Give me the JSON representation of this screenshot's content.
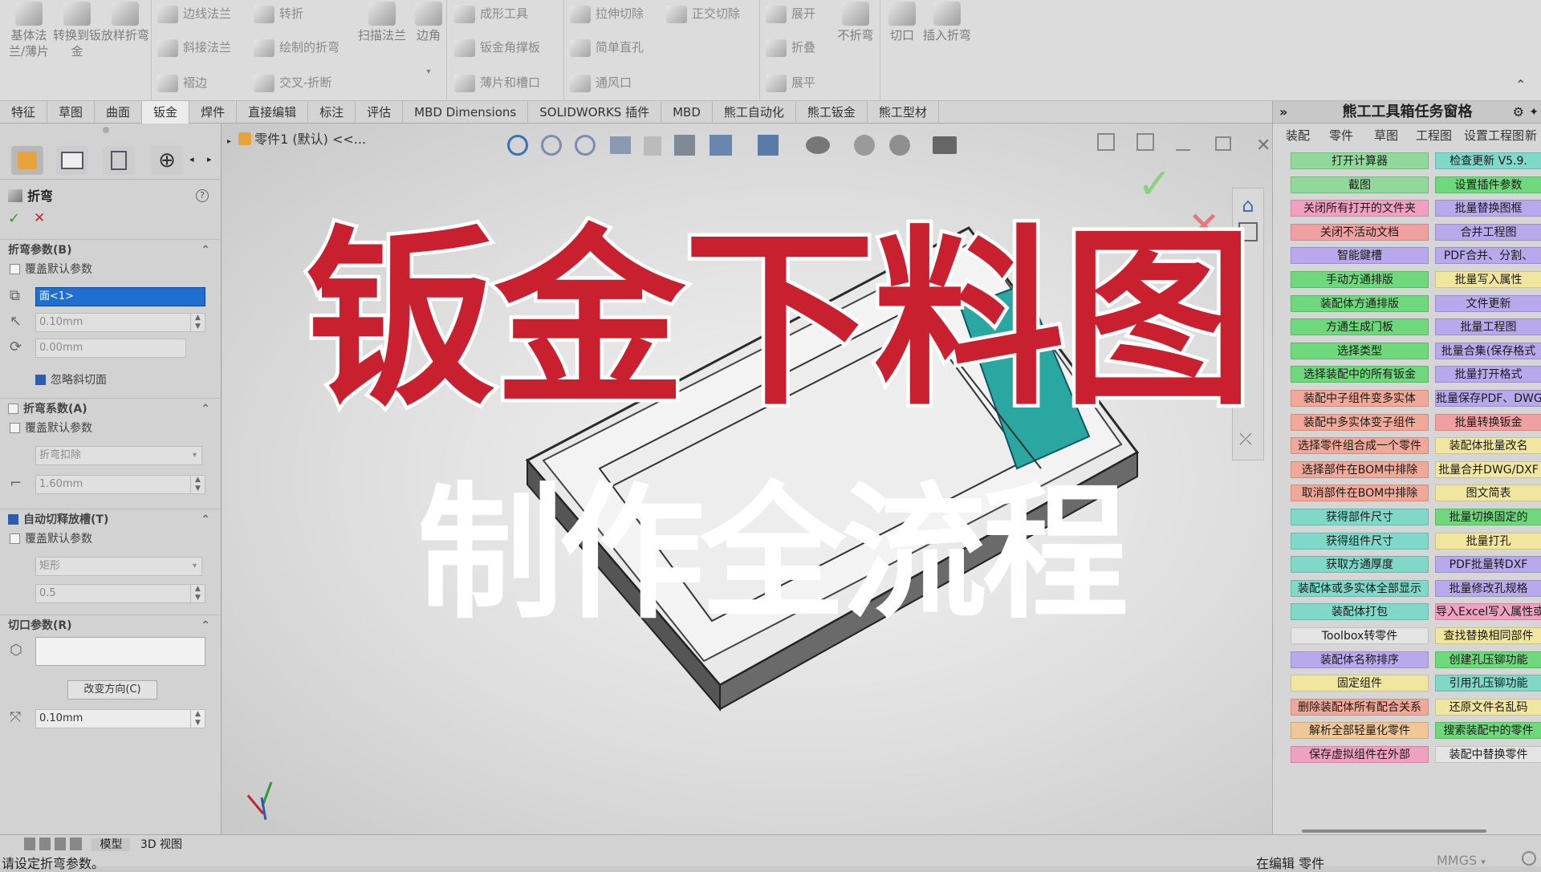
{
  "ribbon": {
    "big_buttons": [
      {
        "label": "基体法兰/薄片"
      },
      {
        "label": "转换到钣金"
      },
      {
        "label": "放样折弯"
      }
    ],
    "small_col1": [
      "边线法兰",
      "斜接法兰",
      "褶边"
    ],
    "small_col2": [
      "转折",
      "绘制的折弯",
      "交叉-折断"
    ],
    "mid_big": [
      {
        "label": "扫描法兰"
      },
      {
        "label": "边角"
      }
    ],
    "small_col3": [
      "成形工具",
      "钣金角撑板",
      "薄片和槽口"
    ],
    "small_col4": [
      "拉伸切除",
      "简单直孔",
      "通风口"
    ],
    "small_col5": [
      "正交切除"
    ],
    "small_col6": [
      "展开",
      "折叠",
      "展平"
    ],
    "right_big": [
      {
        "label": "不折弯"
      },
      {
        "label": "切口"
      },
      {
        "label": "插入折弯"
      }
    ]
  },
  "tabs": [
    "特征",
    "草图",
    "曲面",
    "钣金",
    "焊件",
    "直接编辑",
    "标注",
    "评估",
    "MBD Dimensions",
    "SOLIDWORKS 插件",
    "MBD",
    "熊工自动化",
    "熊工钣金",
    "熊工型材"
  ],
  "active_tab_index": 3,
  "left_panel": {
    "feature_title": "折弯",
    "help_glyph": "?",
    "ok_glyph": "✓",
    "cancel_glyph": "✕",
    "sections": {
      "bend_params": {
        "header": "折弯参数(B)",
        "override": "覆盖默认参数",
        "face_field": "面<1>",
        "radius": "0.10mm",
        "angle": "0.00mm",
        "ignore_bevel": "忽略斜切面"
      },
      "bend_allowance": {
        "header": "折弯系数(A)",
        "override": "覆盖默认参数",
        "type": "折弯扣除",
        "value": "1.60mm"
      },
      "auto_relief": {
        "header": "自动切释放槽(T)",
        "override": "覆盖默认参数",
        "type": "矩形",
        "ratio": "0.5"
      },
      "rip_params": {
        "header": "切口参数(R)",
        "change_direction": "改变方向(C)",
        "gap": "0.10mm"
      }
    }
  },
  "viewport": {
    "breadcrumb": "零件1 (默认) <<..."
  },
  "overlay": {
    "title": "钣金下料图",
    "subtitle": "制作全流程"
  },
  "right_panel": {
    "title": "熊工工具箱任务窗格",
    "tabs": [
      "装配",
      "零件",
      "草图",
      "工程图",
      "设置工程图",
      "新"
    ],
    "col1": [
      {
        "label": "打开计算器",
        "color": "#8fd99a"
      },
      {
        "label": "截图",
        "color": "#8fd99a"
      },
      {
        "label": "关闭所有打开的文件夹",
        "color": "#f0a0c0"
      },
      {
        "label": "关闭不活动文档",
        "color": "#f0a0a0"
      },
      {
        "label": "智能鍵槽",
        "color": "#b8a8ec"
      },
      {
        "label": "手动方通排版",
        "color": "#6fd87c"
      },
      {
        "label": "装配体方通排版",
        "color": "#6fd87c"
      },
      {
        "label": "方通生成门板",
        "color": "#6fd87c"
      },
      {
        "label": "选择类型",
        "color": "#6fd87c"
      },
      {
        "label": "选择装配中的所有钣金",
        "color": "#6fd87c"
      },
      {
        "label": "装配中子组件变多实体",
        "color": "#f0a898"
      },
      {
        "label": "装配中多实体变子组件",
        "color": "#f0a898"
      },
      {
        "label": "选择零件组合成一个零件",
        "color": "#f0a898"
      },
      {
        "label": "选择部件在BOM中排除",
        "color": "#f0a898"
      },
      {
        "label": "取消部件在BOM中排除",
        "color": "#f0a898"
      },
      {
        "label": "获得部件尺寸",
        "color": "#7fd8c8"
      },
      {
        "label": "获得组件尺寸",
        "color": "#7fd8c8"
      },
      {
        "label": "获取方通厚度",
        "color": "#7fd8c8"
      },
      {
        "label": "装配体或多实体全部显示",
        "color": "#7fd8c8"
      },
      {
        "label": "装配体打包",
        "color": "#7fd8c8"
      },
      {
        "label": "Toolbox转零件",
        "color": "#e4e4e4"
      },
      {
        "label": "装配体名称排序",
        "color": "#b8a8ec"
      },
      {
        "label": "固定组件",
        "color": "#f0e6a0"
      },
      {
        "label": "删除装配体所有配合关系",
        "color": "#f0a898"
      },
      {
        "label": "解析全部轻量化零件",
        "color": "#f0c898"
      },
      {
        "label": "保存虚拟组件在外部",
        "color": "#f0a0c0"
      }
    ],
    "col2": [
      {
        "label": "检查更新 V5.9.",
        "color": "#7fd8c8"
      },
      {
        "label": "设置插件参数",
        "color": "#6fd87c"
      },
      {
        "label": "批量替换图框",
        "color": "#b8a8ec"
      },
      {
        "label": "合并工程图",
        "color": "#b8a8ec"
      },
      {
        "label": "PDF合并、分割、",
        "color": "#b8a8ec"
      },
      {
        "label": "批量写入属性",
        "color": "#f0e6a0"
      },
      {
        "label": "文件更新",
        "color": "#b8a8ec"
      },
      {
        "label": "批量工程图",
        "color": "#b8a8ec"
      },
      {
        "label": "批量合集(保存格式",
        "color": "#b8a8ec"
      },
      {
        "label": "批量打开格式",
        "color": "#b8a8ec"
      },
      {
        "label": "批量保存PDF、DWG、",
        "color": "#b8a8ec"
      },
      {
        "label": "批量转换钣金",
        "color": "#f0a0a0"
      },
      {
        "label": "装配体批量改名",
        "color": "#f0e6a0"
      },
      {
        "label": "批量合并DWG/DXF",
        "color": "#f0e6a0"
      },
      {
        "label": "图文简表",
        "color": "#f0e6a0"
      },
      {
        "label": "批量切换固定的",
        "color": "#6fd87c"
      },
      {
        "label": "批量打孔",
        "color": "#f0e6a0"
      },
      {
        "label": "PDF批量转DXF",
        "color": "#b8a8ec"
      },
      {
        "label": "批量修改孔规格",
        "color": "#b8a8ec"
      },
      {
        "label": "导入Excel写入属性或",
        "color": "#f0a0c0"
      },
      {
        "label": "查找替换相同部件",
        "color": "#f0e6a0"
      },
      {
        "label": "创建孔压铆功能",
        "color": "#6fd87c"
      },
      {
        "label": "引用孔压铆功能",
        "color": "#7fd8c8"
      },
      {
        "label": "还原文件名乱码",
        "color": "#f0e6a0"
      },
      {
        "label": "搜索装配中的零件",
        "color": "#6fd87c"
      },
      {
        "label": "装配中替换零件",
        "color": "#e4e4e4"
      }
    ]
  },
  "statusbar": {
    "left": "请设定折弯参数。",
    "tabs": [
      "模型",
      "3D 视图"
    ],
    "mode": "在编辑 零件",
    "units": "MMGS",
    "units_arrow": "▾"
  }
}
